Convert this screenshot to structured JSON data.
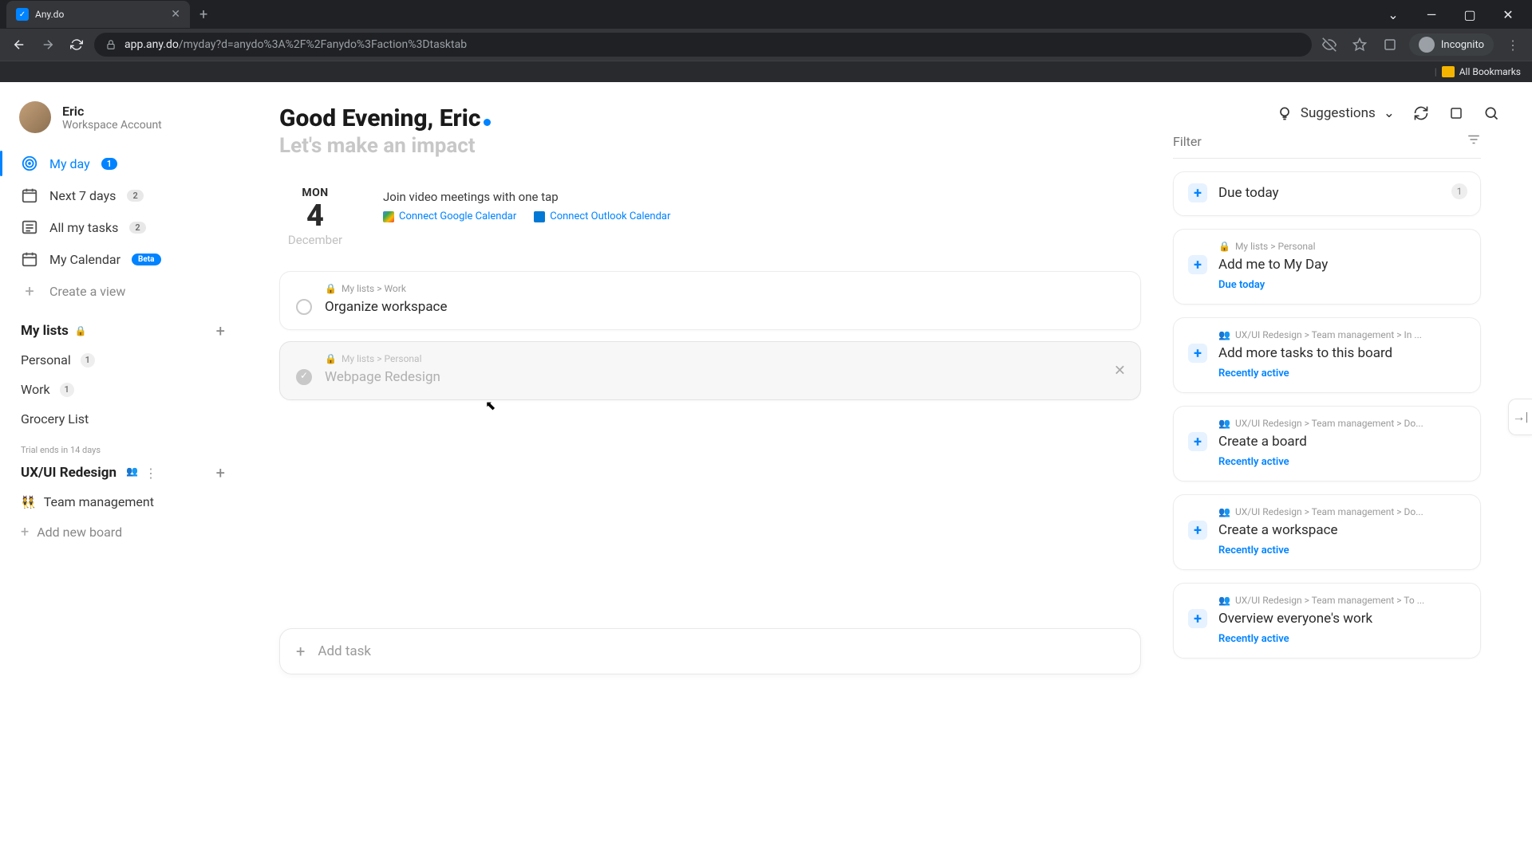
{
  "browser": {
    "tab_title": "Any.do",
    "url_host": "app.any.do",
    "url_path": "/myday?d=anydo%3A%2F%2Fanydo%3Faction%3Dtasktab",
    "incognito_label": "Incognito",
    "bookmarks_label": "All Bookmarks"
  },
  "user": {
    "name": "Eric",
    "subtitle": "Workspace Account"
  },
  "nav": {
    "myday": {
      "label": "My day",
      "count": "1"
    },
    "next7": {
      "label": "Next 7 days",
      "count": "2"
    },
    "all": {
      "label": "All my tasks",
      "count": "2"
    },
    "calendar": {
      "label": "My Calendar",
      "badge": "Beta"
    },
    "create_view": "Create a view"
  },
  "mylists": {
    "header": "My lists",
    "items": [
      {
        "label": "Personal",
        "count": "1"
      },
      {
        "label": "Work",
        "count": "1"
      },
      {
        "label": "Grocery List",
        "count": ""
      }
    ]
  },
  "workspace": {
    "trial": "Trial ends in 14 days",
    "title": "UX/UI Redesign",
    "boards": [
      {
        "emoji": "👯",
        "label": "Team management"
      }
    ],
    "add_board": "Add new board"
  },
  "main": {
    "greeting": "Good Evening, Eric",
    "subtitle": "Let's make an impact",
    "suggestions_label": "Suggestions",
    "filter_placeholder": "Filter",
    "date": {
      "dow": "MON",
      "num": "4",
      "month": "December"
    },
    "connect": {
      "title": "Join video meetings with one tap",
      "google": "Connect Google Calendar",
      "outlook": "Connect Outlook Calendar"
    },
    "tasks": [
      {
        "path": "My lists > Work",
        "title": "Organize workspace",
        "done": false
      },
      {
        "path": "My lists > Personal",
        "title": "Webpage Redesign",
        "done": true
      }
    ],
    "add_task": "Add task"
  },
  "suggestions": {
    "group": {
      "title": "Due today",
      "count": "1"
    },
    "items": [
      {
        "path": "My lists > Personal",
        "title": "Add me to My Day",
        "tag": "Due today"
      },
      {
        "path": "UX/UI Redesign > Team management > In ...",
        "title": "Add more tasks to this board",
        "tag": "Recently active"
      },
      {
        "path": "UX/UI Redesign > Team management > Do...",
        "title": "Create a board",
        "tag": "Recently active"
      },
      {
        "path": "UX/UI Redesign > Team management > Do...",
        "title": "Create a workspace",
        "tag": "Recently active"
      },
      {
        "path": "UX/UI Redesign > Team management > To ...",
        "title": "Overview everyone's work",
        "tag": "Recently active"
      }
    ]
  }
}
